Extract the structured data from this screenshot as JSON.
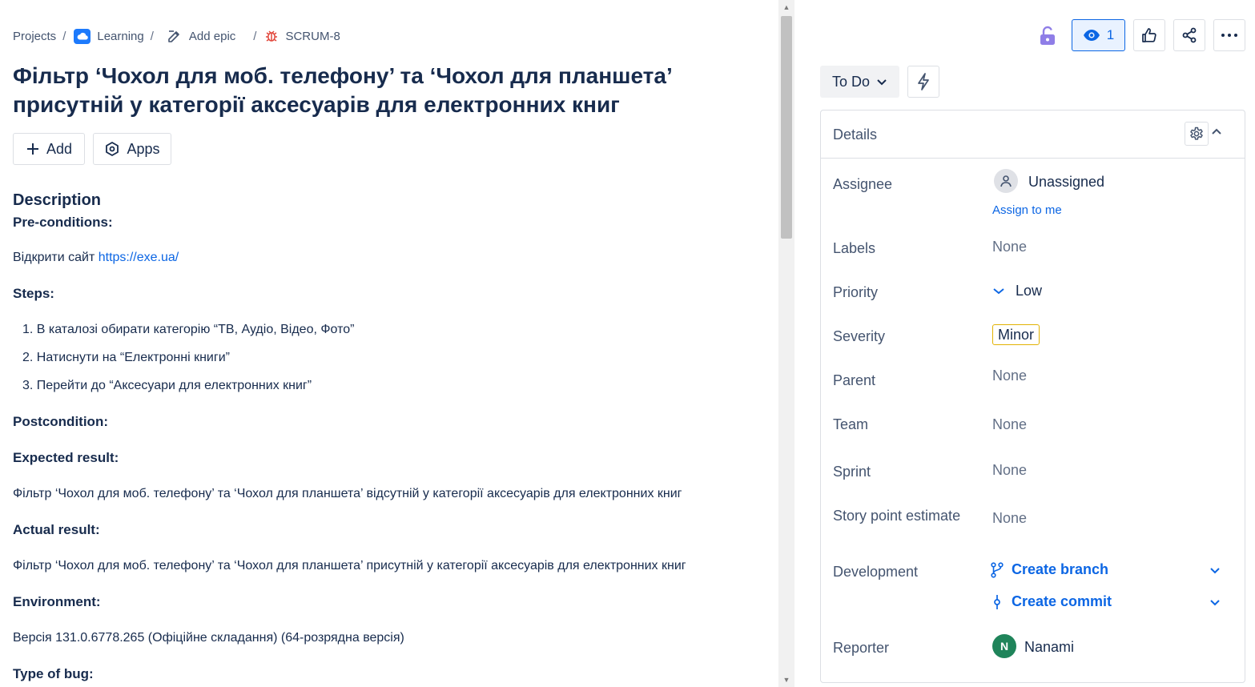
{
  "breadcrumb": {
    "projects": "Projects",
    "project": "Learning",
    "epic": "Add epic",
    "issue_key": "SCRUM-8",
    "separator": "/"
  },
  "issue": {
    "title_line1": "Фільтр ‘Чохол для моб. телефону’ та ‘Чохол для планшета’",
    "title_line2": "присутній у категорії аксесуарів для електронних книг"
  },
  "actions": {
    "add": "Add",
    "apps": "Apps"
  },
  "description": {
    "heading": "Description",
    "preconditions_label": "Pre-conditions:",
    "preconditions_text": "Відкрити сайт ",
    "preconditions_link": "https://exe.ua/",
    "steps_label": "Steps:",
    "steps": [
      "1. В каталозі обирати категорію “ТВ, Аудіо, Відео, Фото”",
      "2. Натиснути на “Електронні книги”",
      "3. Перейти до “Аксесуари для електронних книг”"
    ],
    "postcondition_label": "Postcondition:",
    "expected_label": "Expected result:",
    "expected_text": "Фільтр ‘Чохол для моб. телефону’ та ‘Чохол для планшета’ відсутній у категорії аксесуарів для електронних книг",
    "actual_label": "Actual result:",
    "actual_text": "Фільтр ‘Чохол для моб. телефону’ та ‘Чохол для планшета’ присутній у категорії аксесуарів для електронних книг",
    "environment_label": "Environment:",
    "environment_text": "Версія 131.0.6778.265 (Офіційне складання) (64-розрядна версія)",
    "type_label": "Type of bug:"
  },
  "toolbar": {
    "watch_count": "1"
  },
  "status": {
    "label": "To Do"
  },
  "details": {
    "title": "Details",
    "assignee_label": "Assignee",
    "assignee_value": "Unassigned",
    "assign_to_me": "Assign to me",
    "labels_label": "Labels",
    "labels_value": "None",
    "priority_label": "Priority",
    "priority_value": "Low",
    "severity_label": "Severity",
    "severity_value": "Minor",
    "parent_label": "Parent",
    "parent_value": "None",
    "team_label": "Team",
    "team_value": "None",
    "sprint_label": "Sprint",
    "sprint_value": "None",
    "story_points_label": "Story point estimate",
    "story_points_value": "None",
    "development_label": "Development",
    "create_branch": "Create branch",
    "create_commit": "Create commit",
    "reporter_label": "Reporter",
    "reporter_initial": "N",
    "reporter_name": "Nanami"
  },
  "icons": [
    "lock-icon",
    "eye-icon",
    "thumbs-up-icon",
    "share-icon",
    "more-icon",
    "bolt-icon",
    "gear-icon",
    "chevron-up-icon",
    "chevron-down-icon",
    "branch-icon",
    "commit-icon",
    "bug-icon",
    "edit-icon",
    "cloud-icon",
    "plus-icon",
    "apps-icon",
    "user-icon"
  ],
  "colors": {
    "accent": "#0c66e4",
    "watch_bg": "#e9f2ff",
    "lock": "#8f7ee7",
    "bug": "#e2483d",
    "severity_border": "#e2b203",
    "reporter_avatar": "#1f845a"
  }
}
